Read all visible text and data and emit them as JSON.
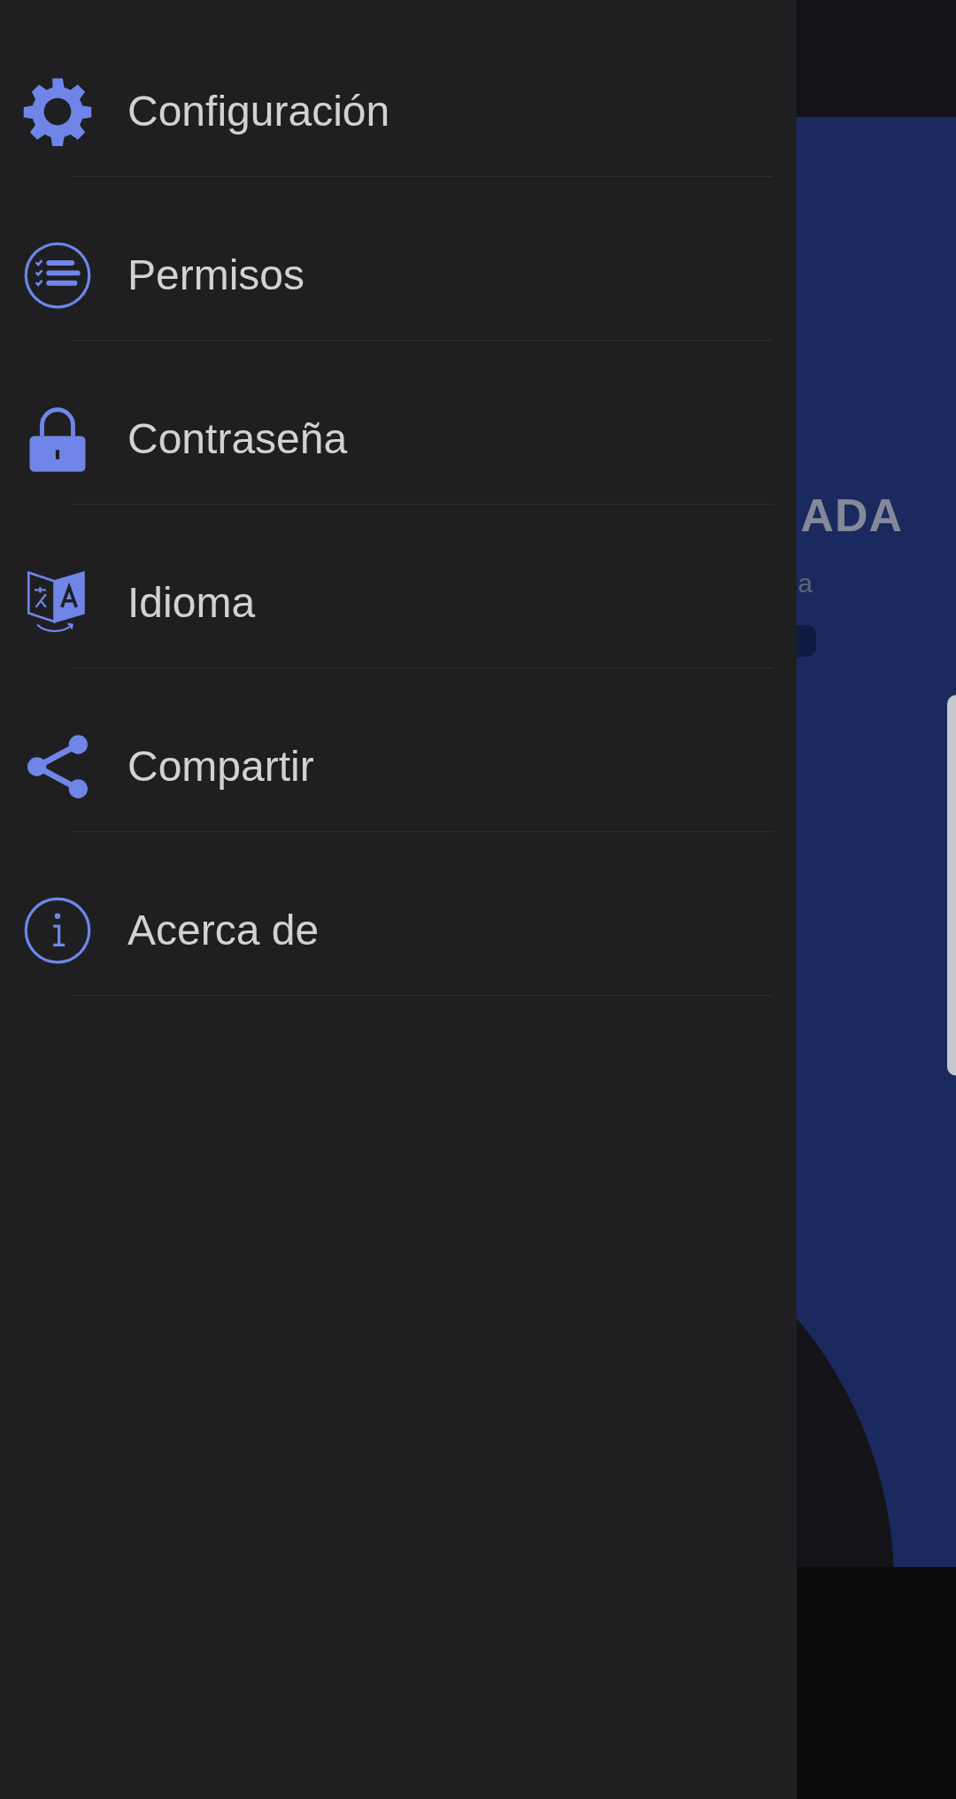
{
  "drawer": {
    "items": [
      {
        "label": "Configuración"
      },
      {
        "label": "Permisos"
      },
      {
        "label": "Contraseña"
      },
      {
        "label": "Idioma"
      },
      {
        "label": "Compartir"
      },
      {
        "label": "Acerca de"
      }
    ]
  },
  "background": {
    "headline": "ADA",
    "subtitle": "a"
  }
}
